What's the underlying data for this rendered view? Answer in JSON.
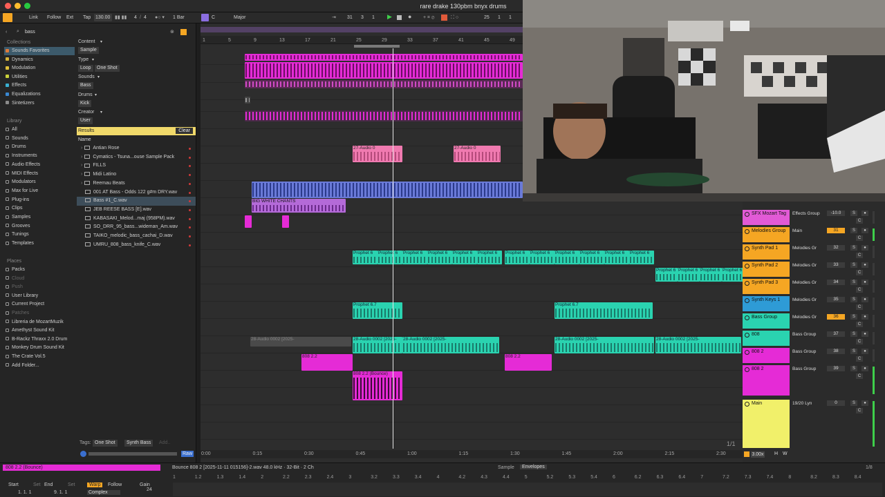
{
  "window": {
    "title": "rare drake 130pbm bnyx drums"
  },
  "transport": {
    "link": "Link",
    "follow": "Follow",
    "ext": "Ext",
    "tap": "Tap",
    "tempo": "130.00",
    "sig_num": "4",
    "sig_den": "4",
    "quant": "1 Bar",
    "key": "C",
    "scale": "Major",
    "pos_bar": "31",
    "pos_beat": "3",
    "pos_six": "1",
    "loop_bar": "25",
    "loop_beat": "1",
    "loop_six": "1"
  },
  "browser": {
    "search": "bass",
    "collections_label": "Collections",
    "collections": [
      {
        "label": "Sounds Favorites",
        "color": "#e07b3a"
      },
      {
        "label": "Dynamics",
        "color": "#d4b33a"
      },
      {
        "label": "Modulation",
        "color": "#e0c03a"
      },
      {
        "label": "Utilities",
        "color": "#c9d13a"
      },
      {
        "label": "Effects",
        "color": "#3ab0d1"
      },
      {
        "label": "Equalizations",
        "color": "#3a88d1"
      },
      {
        "label": "Sintetizers",
        "color": "#8a8a8a"
      }
    ],
    "library_label": "Library",
    "library": [
      "All",
      "Sounds",
      "Drums",
      "Instruments",
      "Audio Effects",
      "MIDI Effects",
      "Modulators",
      "Max for Live",
      "Plug-ins",
      "Clips",
      "Samples",
      "Grooves",
      "Tunings",
      "Templates"
    ],
    "places_label": "Places",
    "places": [
      "Packs",
      "Cloud",
      "Push",
      "User Library",
      "Current Project",
      "Patches",
      "Libreria de MozartMuzik",
      "Amethyst Sound Kit",
      "B-Rackz Thraxx 2.0 Drum",
      "Monkey Drum Sound Kit",
      "The Crate Vol.5",
      "Add Folder..."
    ],
    "filters": [
      {
        "label": "Content",
        "chips": [
          "Sample"
        ]
      },
      {
        "label": "Type",
        "chips": [
          "Loop",
          "One Shot"
        ]
      },
      {
        "label": "Sounds",
        "chips": [
          "Bass"
        ]
      },
      {
        "label": "Drums",
        "chips": [
          "Kick"
        ]
      },
      {
        "label": "Creator",
        "chips": [
          "User"
        ]
      }
    ],
    "results_label": "Results",
    "clear_label": "Clear",
    "name_header": "Name",
    "files": [
      "Antian Rose",
      "Cymatics - Tsuna...ouse Sample Pack",
      "FILLS",
      "Midi Latino",
      "Reemau Beats",
      "001 AT Bass - Odds 122 g#m DRY.wav",
      "Bass #1_C.wav",
      "JEB REESE BASS [E].wav",
      "KABASAKI_Melod...maj (958PM).wav",
      "SO_DRR_95_bass...wideman_Am.wav",
      "TAIKO_melodic_bass_cachai_D.wav",
      "UMRU_808_bass_knife_C.wav"
    ],
    "tags_label": "Tags:",
    "tags": [
      "One Shot",
      "Synth Bass"
    ],
    "tags_add": "Add..",
    "raw_label": "Raw"
  },
  "ruler": {
    "bars": [
      "1",
      "5",
      "9",
      "13",
      "17",
      "21",
      "25",
      "29",
      "33",
      "37",
      "41",
      "45",
      "49"
    ]
  },
  "clips": {
    "audio27": "27-Audio 0",
    "audio27b": "27-Audio 0",
    "chants": "BIG WHITE CHANTS",
    "prophet6": "Prophet 6",
    "prophet67": "Prophet 6.7",
    "audio28": "28-Audio 0002 [2025-",
    "bass808": "808 2.2",
    "bounce": "808 2.2 (Bounce)"
  },
  "timeline": [
    "0:00",
    "0:15",
    "0:30",
    "0:45",
    "1:00",
    "1:15",
    "1:30",
    "1:45",
    "2:00",
    "2:15",
    "2:30"
  ],
  "page_counter": "1/1",
  "mixer": {
    "tracks": [
      {
        "name": "SFX Mozart Tag",
        "color": "#e25ad6",
        "route": "Effects Group",
        "vol": "-10.0"
      },
      {
        "name": "Melodies Group",
        "color": "#f5a623",
        "route": "Main",
        "vol": "31"
      },
      {
        "name": "Synth Pad 1",
        "color": "#f5a623",
        "route": "Melodies Gr",
        "vol": "32"
      },
      {
        "name": "Synth Pad 2",
        "color": "#f5a623",
        "route": "Melodies Gr",
        "vol": "33"
      },
      {
        "name": "Synth Pad 3",
        "color": "#f5a623",
        "route": "Melodies Gr",
        "vol": "34"
      },
      {
        "name": "Synth Keys 1",
        "color": "#2e9bd6",
        "route": "Melodies Gr",
        "vol": "35"
      },
      {
        "name": "Bass Group",
        "color": "#2ad3b0",
        "route": "Melodies Gr",
        "vol": "36"
      },
      {
        "name": "808",
        "color": "#2ad3b0",
        "route": "Bass Group",
        "vol": "37"
      },
      {
        "name": "808 2",
        "color": "#e52bd6",
        "route": "Bass Group",
        "vol": "38"
      },
      {
        "name": "808 2",
        "color": "#e52bd6",
        "route": "Bass Group",
        "vol": "39"
      },
      {
        "name": "Main",
        "color": "#f1f06a",
        "route": "19/20 Lyn",
        "vol": "0"
      }
    ],
    "zoom": "3.00x",
    "h_label": "H",
    "w_label": "W"
  },
  "clip_view": {
    "clip_name": "808 2.2 (Bounce)",
    "file_info": "Bounce 808 2 [2025-11-11 015156]-2.wav  48.0 kHz · 32-Bit · 2 Ch",
    "sample_tab": "Sample",
    "envelopes_tab": "Envelopes",
    "start_label": "Start",
    "end_label": "End",
    "set_label": "Set",
    "start_value": "1.  1.  1",
    "end_value": "9.  1.  1",
    "warp_label": "Warp",
    "follow_label": "Follow",
    "mode": "Complex",
    "gain_label": "Gain",
    "gain_value": "24",
    "page": "1/8",
    "ruler": [
      "1",
      "1.2",
      "1.3",
      "1.4",
      "2",
      "2.2",
      "2.3",
      "2.4",
      "3",
      "3.2",
      "3.3",
      "3.4",
      "4",
      "4.2",
      "4.3",
      "4.4",
      "5",
      "5.2",
      "5.3",
      "5.4",
      "6",
      "6.2",
      "6.3",
      "6.4",
      "7",
      "7.2",
      "7.3",
      "7.4",
      "8",
      "8.2",
      "8.3",
      "8.4"
    ]
  }
}
